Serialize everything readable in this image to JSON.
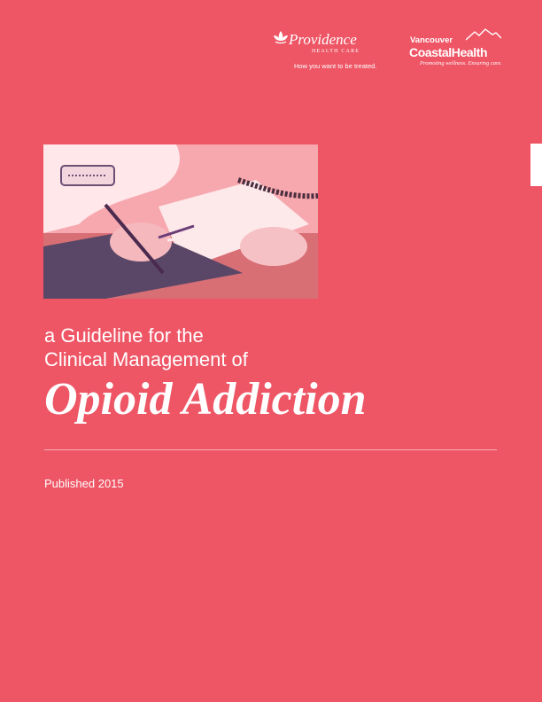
{
  "logos": {
    "providence": {
      "name": "Providence",
      "subtitle": "HEALTH CARE",
      "tagline": "How you want to be treated."
    },
    "vch": {
      "line1": "Vancouver",
      "line2": "CoastalHealth",
      "tagline": "Promoting wellness. Ensuring care."
    }
  },
  "cover": {
    "title_line1": "a Guideline for the",
    "title_line2": "Clinical Management of",
    "title_main": "Opioid Addiction",
    "published": "Published 2015"
  },
  "colors": {
    "background": "#ee5565",
    "text": "#ffffff",
    "rule": "#f7b2b9"
  }
}
